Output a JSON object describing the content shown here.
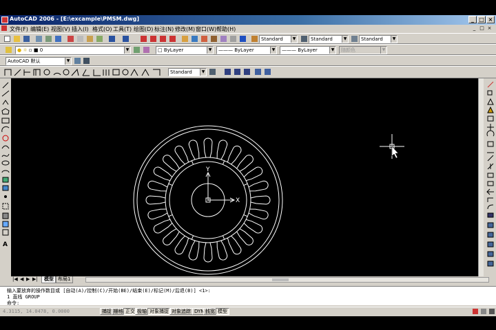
{
  "window": {
    "title": "AutoCAD 2006 - [E:\\excample\\PMSM.dwg]",
    "minimize": "_",
    "maximize": "□",
    "close": "×"
  },
  "menu": {
    "items": [
      "文件(F)",
      "编辑(E)",
      "视图(V)",
      "插入(I)",
      "格式(O)",
      "工具(T)",
      "绘图(D)",
      "标注(N)",
      "修改(M)",
      "窗口(W)",
      "帮助(H)"
    ]
  },
  "toolbar": {
    "text_style": "Standard",
    "dim_style": "Standard",
    "table_style": "Standard",
    "layer": "0",
    "color": "ByLayer",
    "linetype": "ByLayer",
    "lineweight": "ByLayer",
    "plotstyle": "随颜色",
    "workspace": "AutoCAD 默认",
    "dim_style_2": "Standard"
  },
  "drawing": {
    "ucs_x": "X",
    "ucs_y": "Y"
  },
  "layout_tabs": [
    "模型",
    "布局1"
  ],
  "command": {
    "line1": "输入要放弃的操作数目或 [自动(A)/控制(C)/开始(BE)/结束(E)/标记(M)/后退(B)] <1>:",
    "line2": "1 直线 GROUP",
    "prompt": "命令:"
  },
  "status": {
    "coords": "4.3115, 14.0478, 0.0000",
    "toggles": [
      {
        "label": "捕捉",
        "on": false
      },
      {
        "label": "栅格",
        "on": false
      },
      {
        "label": "正交",
        "on": true
      },
      {
        "label": "极轴",
        "on": false
      },
      {
        "label": "对象捕捉",
        "on": true
      },
      {
        "label": "对象追踪",
        "on": false
      },
      {
        "label": "DYN",
        "on": false
      },
      {
        "label": "线宽",
        "on": false
      },
      {
        "label": "模型",
        "on": true
      }
    ]
  },
  "colors": {
    "titlebar": "#0a246a",
    "chrome": "#d4d0c8",
    "drawing_bg": "#000000",
    "drawing_lines": "#ffffff"
  }
}
